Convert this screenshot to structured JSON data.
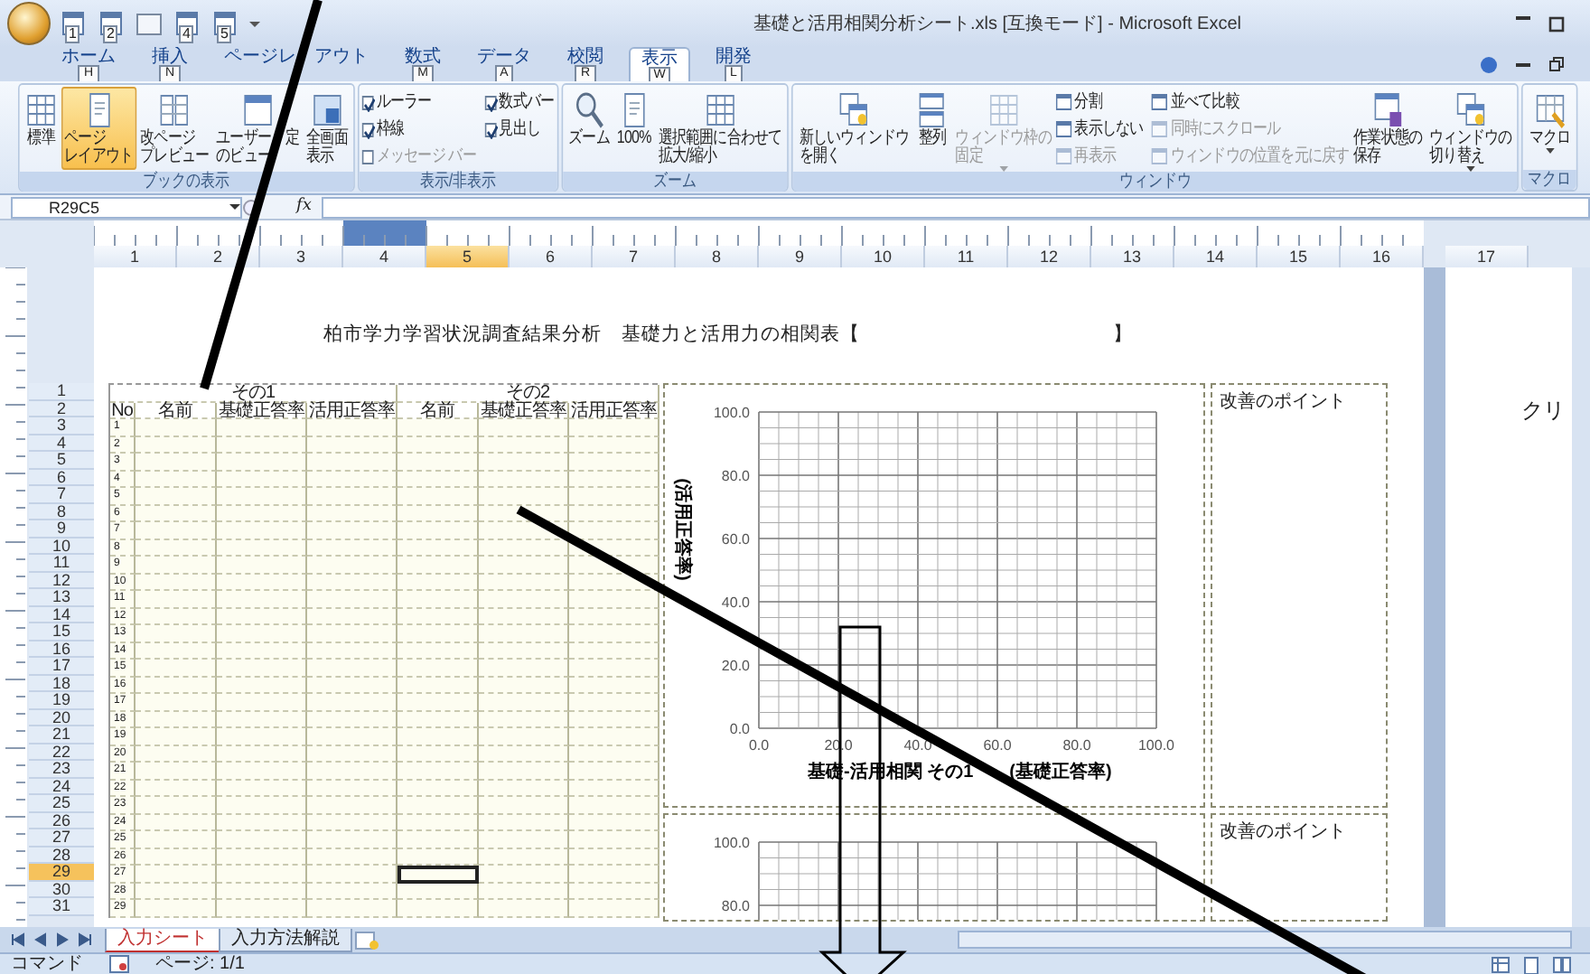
{
  "window": {
    "title": "基礎と活用相関分析シート.xls [互換モード] - Microsoft Excel"
  },
  "quick_access": [
    {
      "kind": "keytip",
      "keytip": "1"
    },
    {
      "kind": "keytip",
      "keytip": "2"
    },
    {
      "kind": "plain"
    },
    {
      "kind": "keytip",
      "keytip": "4"
    },
    {
      "kind": "keytip",
      "keytip": "5"
    }
  ],
  "tabs": [
    {
      "label": "ホーム",
      "keytip": "H",
      "selected": false
    },
    {
      "label": "挿入",
      "keytip": "N",
      "selected": false
    },
    {
      "label": [
        "ページレ",
        "アウト"
      ],
      "selected": false
    },
    {
      "label": "数式",
      "keytip": "M",
      "selected": false
    },
    {
      "label": "データ",
      "keytip": "A",
      "selected": false
    },
    {
      "label": "校閲",
      "keytip": "R",
      "selected": false
    },
    {
      "label": "表示",
      "keytip": "W",
      "selected": true
    },
    {
      "label": "開発",
      "keytip": "L",
      "selected": false
    }
  ],
  "ribbon": {
    "groups": [
      {
        "label": "ブックの表示",
        "items": [
          {
            "kind": "large",
            "lines": [
              "標準"
            ],
            "selected": false,
            "disabled": false
          },
          {
            "kind": "large",
            "lines": [
              "ページ",
              "レイアウト"
            ],
            "selected": true,
            "disabled": false
          },
          {
            "kind": "large",
            "lines": [
              "改ページ",
              "プレビュー"
            ],
            "selected": false,
            "disabled": false
          },
          {
            "kind": "large",
            "lines": [
              [
                "ユーザー",
                "定"
              ],
              "のビュー"
            ],
            "selected": false,
            "disabled": false
          },
          {
            "kind": "large",
            "lines": [
              "全画面",
              "表示"
            ],
            "selected": false,
            "disabled": false
          }
        ]
      },
      {
        "label": "表示/非表示",
        "items": [
          {
            "kind": "check",
            "label": "ルーラー",
            "checked": true,
            "disabled": false
          },
          {
            "kind": "check",
            "label": "枠線",
            "checked": true,
            "disabled": false
          },
          {
            "kind": "check",
            "label": "メッセージ バー",
            "checked": false,
            "disabled": true
          },
          {
            "kind": "check",
            "label": "数式バー",
            "checked": true,
            "disabled": false
          },
          {
            "kind": "check",
            "label": "見出し",
            "checked": true,
            "disabled": false
          }
        ]
      },
      {
        "label": "ズーム",
        "items": [
          {
            "kind": "large",
            "lines": [
              "ズーム"
            ],
            "disabled": false
          },
          {
            "kind": "large",
            "lines": [
              "100%"
            ],
            "disabled": false
          },
          {
            "kind": "large",
            "lines": [
              "選択範囲に合わせて",
              "拡大/縮小"
            ],
            "disabled": false
          }
        ]
      },
      {
        "label": "ウィンドウ",
        "items": [
          {
            "kind": "large",
            "lines": [
              "新しいウィンドウ",
              "を開く"
            ],
            "disabled": false
          },
          {
            "kind": "large",
            "lines": [
              "整列"
            ],
            "disabled": false
          },
          {
            "kind": "large",
            "lines": [
              "ウィンドウ枠の",
              "固定"
            ],
            "disabled": true,
            "dropdown": true
          },
          {
            "kind": "small",
            "label": "分割",
            "disabled": false
          },
          {
            "kind": "small",
            "label": "表示しない",
            "disabled": false
          },
          {
            "kind": "small",
            "label": "再表示",
            "disabled": true
          },
          {
            "kind": "small",
            "label": "並べて比較",
            "disabled": false
          },
          {
            "kind": "small",
            "label": "同時にスクロール",
            "disabled": true
          },
          {
            "kind": "small",
            "label": "ウィンドウの位置を元に戻す",
            "disabled": true
          },
          {
            "kind": "large",
            "lines": [
              "作業状態の",
              "保存"
            ],
            "disabled": false
          },
          {
            "kind": "large",
            "lines": [
              "ウィンドウの",
              "切り替え"
            ],
            "disabled": false,
            "dropdown": true
          }
        ]
      },
      {
        "label": "マクロ",
        "items": [
          {
            "kind": "large",
            "lines": [
              "マクロ"
            ],
            "disabled": false,
            "dropdown": true
          }
        ]
      }
    ]
  },
  "formula_bar": {
    "name_box": "R29C5",
    "function_label": "fx"
  },
  "column_headers": [
    {
      "label": "1",
      "selected": false
    },
    {
      "label": "2",
      "selected": false
    },
    {
      "label": "3",
      "selected": false
    },
    {
      "label": "4",
      "selected": false
    },
    {
      "label": "5",
      "selected": true
    },
    {
      "label": "6",
      "selected": false
    },
    {
      "label": "7",
      "selected": false
    },
    {
      "label": "8",
      "selected": false
    },
    {
      "label": "9",
      "selected": false
    },
    {
      "label": "10",
      "selected": false
    },
    {
      "label": "11",
      "selected": false
    },
    {
      "label": "12",
      "selected": false
    },
    {
      "label": "13",
      "selected": false
    },
    {
      "label": "14",
      "selected": false
    },
    {
      "label": "15",
      "selected": false
    },
    {
      "label": "16",
      "selected": false
    },
    {
      "label": "17",
      "selected": false
    }
  ],
  "row_headers": [
    {
      "label": "1",
      "selected": false
    },
    {
      "label": "2",
      "selected": false
    },
    {
      "label": "3",
      "selected": false
    },
    {
      "label": "4",
      "selected": false
    },
    {
      "label": "5",
      "selected": false
    },
    {
      "label": "6",
      "selected": false
    },
    {
      "label": "7",
      "selected": false
    },
    {
      "label": "8",
      "selected": false
    },
    {
      "label": "9",
      "selected": false
    },
    {
      "label": "10",
      "selected": false
    },
    {
      "label": "11",
      "selected": false
    },
    {
      "label": "12",
      "selected": false
    },
    {
      "label": "13",
      "selected": false
    },
    {
      "label": "14",
      "selected": false
    },
    {
      "label": "15",
      "selected": false
    },
    {
      "label": "16",
      "selected": false
    },
    {
      "label": "17",
      "selected": false
    },
    {
      "label": "18",
      "selected": false
    },
    {
      "label": "19",
      "selected": false
    },
    {
      "label": "20",
      "selected": false
    },
    {
      "label": "21",
      "selected": false
    },
    {
      "label": "22",
      "selected": false
    },
    {
      "label": "23",
      "selected": false
    },
    {
      "label": "24",
      "selected": false
    },
    {
      "label": "25",
      "selected": false
    },
    {
      "label": "26",
      "selected": false
    },
    {
      "label": "27",
      "selected": false
    },
    {
      "label": "28",
      "selected": false
    },
    {
      "label": "29",
      "selected": true
    },
    {
      "label": "30",
      "selected": false
    },
    {
      "label": "31",
      "selected": false
    }
  ],
  "page": {
    "title": "柏市学力学習状況調査結果分析　基礎力と活用力の相関表【",
    "title_close": "】",
    "table": {
      "groups": [
        "その1",
        "その2"
      ],
      "columns": [
        "No",
        "名前",
        "基礎正答率",
        "活用正答率",
        "名前",
        "基礎正答率",
        "活用正答率"
      ],
      "rows": [
        {
          "no": "1",
          "selected": false
        },
        {
          "no": "2",
          "selected": false
        },
        {
          "no": "3",
          "selected": false
        },
        {
          "no": "4",
          "selected": false
        },
        {
          "no": "5",
          "selected": false
        },
        {
          "no": "6",
          "selected": false
        },
        {
          "no": "7",
          "selected": false
        },
        {
          "no": "8",
          "selected": false
        },
        {
          "no": "9",
          "selected": false
        },
        {
          "no": "10",
          "selected": false
        },
        {
          "no": "11",
          "selected": false
        },
        {
          "no": "12",
          "selected": false
        },
        {
          "no": "13",
          "selected": false
        },
        {
          "no": "14",
          "selected": false
        },
        {
          "no": "15",
          "selected": false
        },
        {
          "no": "16",
          "selected": false
        },
        {
          "no": "17",
          "selected": false
        },
        {
          "no": "18",
          "selected": false
        },
        {
          "no": "19",
          "selected": false
        },
        {
          "no": "20",
          "selected": false
        },
        {
          "no": "21",
          "selected": false
        },
        {
          "no": "22",
          "selected": false
        },
        {
          "no": "23",
          "selected": false
        },
        {
          "no": "24",
          "selected": false
        },
        {
          "no": "25",
          "selected": false
        },
        {
          "no": "26",
          "selected": false
        },
        {
          "no": "27",
          "selected": true
        },
        {
          "no": "28",
          "selected": false
        },
        {
          "no": "29",
          "selected": false
        }
      ]
    },
    "charts": [
      {
        "chart_data": {
          "type": "scatter",
          "grid": true,
          "xlabel": "基礎-活用相関 その1　　(基礎正答率)",
          "ylabel": "(活用正答率)",
          "xlim": [
            0,
            100
          ],
          "ylim": [
            0,
            100
          ],
          "xticks": [
            {
              "value": 0,
              "label": "0.0"
            },
            {
              "value": 20,
              "label": "20.0"
            },
            {
              "value": 40,
              "label": "40.0"
            },
            {
              "value": 60,
              "label": "60.0"
            },
            {
              "value": 80,
              "label": "80.0"
            },
            {
              "value": 100,
              "label": "100.0"
            }
          ],
          "yticks": [
            {
              "value": 0,
              "label": "0.0"
            },
            {
              "value": 20,
              "label": "20.0"
            },
            {
              "value": 40,
              "label": "40.0"
            },
            {
              "value": 60,
              "label": "60.0"
            },
            {
              "value": 80,
              "label": "80.0"
            },
            {
              "value": 100,
              "label": "100.0"
            }
          ]
        }
      },
      {
        "chart_data": {
          "type": "scatter",
          "grid": true,
          "xlim": [
            0,
            100
          ],
          "ylim": [
            0,
            100
          ],
          "yticks": [
            {
              "value": 80,
              "label": "80.0"
            },
            {
              "value": 100,
              "label": "100.0"
            }
          ]
        }
      }
    ],
    "notes": [
      {
        "title": "改善のポイント"
      },
      {
        "title": "改善のポイント"
      }
    ]
  },
  "page2": {
    "text": "クリ"
  },
  "sheet_tabs": [
    {
      "label": "入力シート",
      "selected": true
    },
    {
      "label": "入力方法解説",
      "selected": false
    }
  ],
  "status_bar": {
    "mode": "コマンド",
    "page": "ページ: 1/1"
  },
  "overlay_marks": [
    {
      "kind": "line"
    },
    {
      "kind": "line"
    },
    {
      "kind": "arrow"
    }
  ]
}
